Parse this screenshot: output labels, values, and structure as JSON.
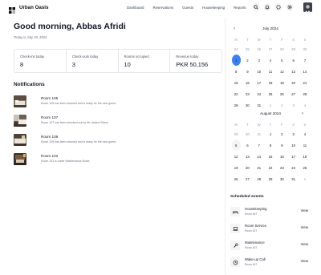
{
  "app": {
    "brand": "Urban Oasis"
  },
  "nav": [
    "Dashboard",
    "Reservations",
    "Guests",
    "Housekeeping",
    "Reports"
  ],
  "header_icons": [
    "search-icon",
    "bell-icon",
    "chat-icon",
    "settings-icon"
  ],
  "greeting": "Good morning, Abbas Afridi",
  "date_line": "Today is July 18, 2024",
  "stats": [
    {
      "label": "Check-ins today",
      "value": "8"
    },
    {
      "label": "Check-outs today",
      "value": "3"
    },
    {
      "label": "Rooms occupied",
      "value": "10"
    },
    {
      "label": "Revenue today",
      "value": "PKR 50,156"
    }
  ],
  "notifications": {
    "title": "Notifications",
    "items": [
      {
        "title": "Room 105",
        "message": "Room 105 has been cleaned and is ready for the next guest."
      },
      {
        "title": "Room 107",
        "message": "Room 107 has been checked out by Mr. Asfand Sheer."
      },
      {
        "title": "Room 109",
        "message": "Room 109 has been cleaned and is ready for the next guest."
      },
      {
        "title": "Room 103",
        "message": "Room 103 is under Maintenance Mode."
      }
    ]
  },
  "calendars": [
    {
      "month": "July 2024",
      "dow": [
        "M",
        "T",
        "W",
        "T",
        "F",
        "S",
        "S"
      ],
      "weeks": [
        [
          "24",
          "25",
          "26",
          "27",
          "28",
          "29",
          "30"
        ],
        [
          "1",
          "2",
          "3",
          "4",
          "5",
          "6",
          "7"
        ],
        [
          "8",
          "9",
          "10",
          "11",
          "12",
          "13",
          "14"
        ],
        [
          "15",
          "16",
          "17",
          "18",
          "19",
          "20",
          "21"
        ],
        [
          "22",
          "23",
          "24",
          "25",
          "26",
          "27",
          "28"
        ],
        [
          "29",
          "30",
          "31",
          "1",
          "2",
          "3",
          "4"
        ]
      ],
      "selected": "1"
    },
    {
      "month": "August 2024",
      "dow": [
        "M",
        "T",
        "W",
        "T",
        "F",
        "S",
        "S"
      ],
      "weeks": [
        [
          "29",
          "30",
          "31",
          "1",
          "2",
          "3",
          "4"
        ],
        [
          "5",
          "6",
          "7",
          "8",
          "9",
          "10",
          "11"
        ],
        [
          "12",
          "13",
          "14",
          "15",
          "16",
          "17",
          "18"
        ],
        [
          "19",
          "20",
          "21",
          "22",
          "23",
          "24",
          "25"
        ],
        [
          "26",
          "27",
          "28",
          "29",
          "30",
          "31",
          "1"
        ]
      ],
      "selected": "5"
    }
  ],
  "events": {
    "title": "Scheduled events",
    "view_label": "View",
    "items": [
      {
        "name": "Housekeeping",
        "room": "Room 407",
        "icon": "bed-icon"
      },
      {
        "name": "Room Service",
        "room": "Room 407",
        "icon": "laptop-icon"
      },
      {
        "name": "Maintenance",
        "room": "Room 407",
        "icon": "wrench-icon"
      },
      {
        "name": "Wake-up Call",
        "room": "Room 407",
        "icon": "clock-icon"
      }
    ]
  },
  "colors": {
    "accent": "#3b82f6",
    "text": "#111827",
    "muted": "#6b7280",
    "border": "#e5e7eb"
  }
}
